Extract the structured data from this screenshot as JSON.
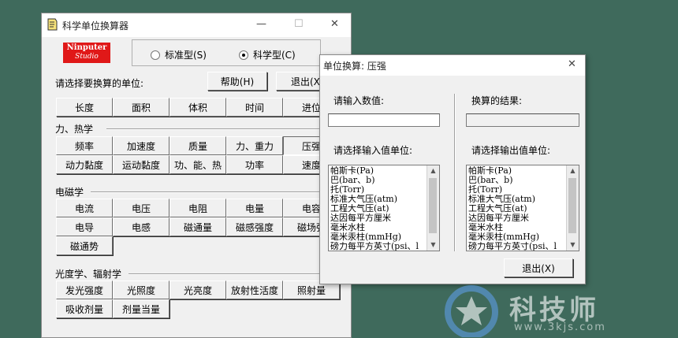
{
  "main_window": {
    "title": "科学单位换算器",
    "controls": {
      "minimize": "—",
      "maximize": "☐",
      "close": "✕"
    },
    "logo": {
      "line1": "Ninputer",
      "line2": "Studio"
    },
    "mode": {
      "standard": "标准型(S)",
      "scientific": "科学型(C)",
      "selected": "scientific"
    },
    "prompt": "请选择要换算的单位:",
    "help_button": "帮助(H)",
    "exit_button": "退出(X)",
    "basic_units": [
      "长度",
      "面积",
      "体积",
      "时间",
      "进位"
    ],
    "groups": {
      "mechanics": {
        "title": "力、热学",
        "row1": [
          "频率",
          "加速度",
          "质量",
          "力、重力",
          "压强"
        ],
        "row2": [
          "动力黏度",
          "运动黏度",
          "功、能、热",
          "功率",
          "速度"
        ]
      },
      "electromagnetism": {
        "title": "电磁学",
        "row1": [
          "电流",
          "电压",
          "电阻",
          "电量",
          "电容"
        ],
        "row2": [
          "电导",
          "电感",
          "磁通量",
          "磁感强度",
          "磁场强"
        ],
        "row3": [
          "磁通势"
        ]
      },
      "optics": {
        "title": "光度学、辐射学",
        "row1": [
          "发光强度",
          "光照度",
          "光亮度",
          "放射性活度",
          "照射量"
        ],
        "row2": [
          "吸收剂量",
          "剂量当量"
        ]
      }
    }
  },
  "dialog": {
    "title": "单位换算: 压强",
    "close": "✕",
    "input_label": "请输入数值:",
    "result_label": "换算的结果:",
    "input_value": "",
    "result_value": "",
    "input_unit_label": "请选择输入值单位:",
    "output_unit_label": "请选择输出值单位:",
    "units": [
      "帕斯卡(Pa)",
      "巴(bar、b)",
      "托(Torr)",
      "标准大气压(atm)",
      "工程大气压(at)",
      "达因每平方厘米",
      "毫米水柱",
      "毫米汞柱(mmHg)",
      "磅力每平方英寸(psi、l"
    ],
    "exit_button": "退出(X)"
  },
  "watermark": {
    "text": "科技师",
    "url": "www.3kjs.com"
  },
  "colors": {
    "desktop": "#3f6a5c",
    "window": "#f0f0f0",
    "logo": "#e01818"
  }
}
